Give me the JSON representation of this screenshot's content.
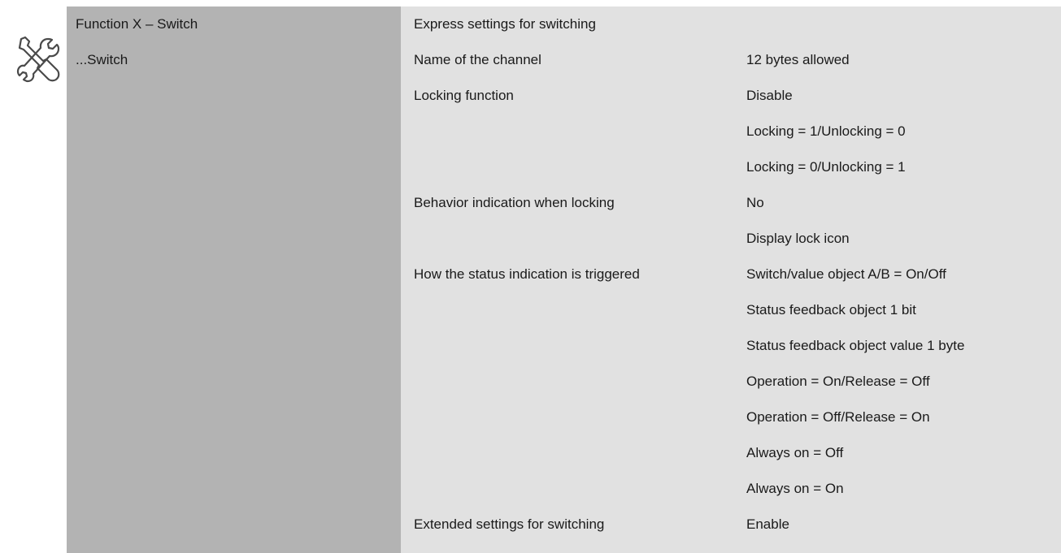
{
  "icon": "tools-icon",
  "colors": {
    "left_panel": "#b3b3b3",
    "right_panel": "#e1e1e1",
    "text": "#1a1a1a"
  },
  "tree": {
    "items": [
      {
        "label": "Function X – Switch"
      },
      {
        "label": "...Switch"
      }
    ]
  },
  "parameters": {
    "heading": "Express settings for switching",
    "rows": [
      {
        "label": "Name of the channel",
        "options": [
          "12 bytes allowed"
        ]
      },
      {
        "label": "Locking function",
        "options": [
          "Disable",
          "Locking = 1/Unlocking = 0",
          "Locking = 0/Unlocking = 1"
        ]
      },
      {
        "label": "Behavior indication when locking",
        "options": [
          "No",
          "Display lock icon"
        ]
      },
      {
        "label": "How the status indication is triggered",
        "options": [
          "Switch/value object A/B = On/Off",
          "Status feedback object 1 bit",
          "Status feedback object value 1 byte",
          "Operation = On/Release = Off",
          "Operation = Off/Release = On",
          "Always on = Off",
          "Always on = On"
        ]
      },
      {
        "label": "Extended settings for switching",
        "options": [
          "Enable"
        ]
      }
    ]
  }
}
